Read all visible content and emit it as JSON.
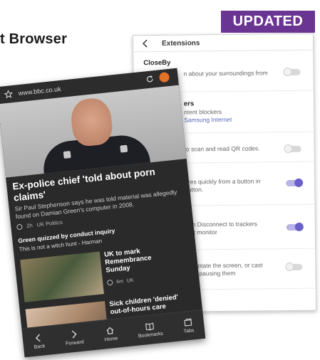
{
  "page": {
    "headline": "t Browser",
    "badge": "UPDATED"
  },
  "extensions": {
    "title": "Extensions",
    "rows": [
      {
        "title": "CloseBy",
        "desc": "n about your surroundings from",
        "link": "",
        "toggle": false
      },
      {
        "title": "ers",
        "desc": "ntent blockers",
        "link": "Samsung Internet",
        "toggle": null
      },
      {
        "title": "",
        "desc": "to scan and read QR codes.",
        "link": "",
        "toggle": false
      },
      {
        "title": "",
        "desc": "ures quickly from a button in button.",
        "link": "",
        "toggle": true
      },
      {
        "title": "",
        "desc": "rom Disconnect to trackers that monitor",
        "link": "",
        "toggle": true
      },
      {
        "title": "",
        "desc": "de, rotate the screen, or cast hout pausing them",
        "link": "",
        "toggle": false
      }
    ]
  },
  "browser": {
    "url": "www.bbc.co.uk",
    "lead": {
      "title": "Ex-police chief 'told about porn claims'",
      "desc": "Sir Paul Stephenson says he was told material was allegedly found on Damian Green's computer in 2008.",
      "time": "2h",
      "section": "UK Politics"
    },
    "related": {
      "title": "Green quizzed by conduct inquiry",
      "subtitle": "This is not a witch hunt - Harman"
    },
    "stories": [
      {
        "title": "UK to mark Remembrance Sunday",
        "time": "6m",
        "section": "UK"
      },
      {
        "title": "Sick children 'denied' out-of-hours care",
        "time": "",
        "section": ""
      }
    ],
    "toolbar": {
      "back": "Back",
      "forward": "Forward",
      "home": "Home",
      "bookmarks": "Bookmarks",
      "tabs": "Tabs"
    }
  }
}
